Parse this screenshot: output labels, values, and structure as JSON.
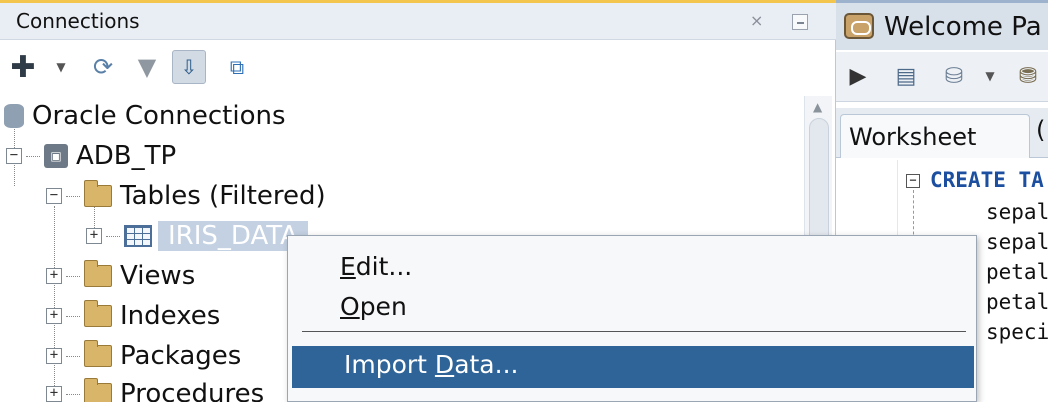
{
  "connections_panel": {
    "title": "Connections",
    "close_glyph": "×"
  },
  "tree": {
    "root": "Oracle Connections",
    "connection": "ADB_TP",
    "tables": "Tables (Filtered)",
    "selected_table": "IRIS_DATA",
    "folders": [
      "Views",
      "Indexes",
      "Packages",
      "Procedures"
    ]
  },
  "context_menu": {
    "items": [
      {
        "label_pre": "",
        "mnemonic": "E",
        "label_post": "dit..."
      },
      {
        "label_pre": "",
        "mnemonic": "O",
        "label_post": "pen"
      },
      {
        "label_pre": "Import ",
        "mnemonic": "D",
        "label_post": "ata..."
      }
    ],
    "highlighted_index": 2,
    "highlight_color": "#2f6498"
  },
  "welcome_panel": {
    "title": "Welcome Pa"
  },
  "worksheet": {
    "tab_label": "Worksheet",
    "second_tab_label": "(",
    "code": {
      "line1_keyword": "CREATE TA",
      "lines": [
        "sepal",
        "sepal",
        "petal",
        "petal",
        "speci"
      ]
    }
  },
  "icons": {
    "add": "add-connection-icon",
    "refresh": "refresh-icon",
    "filter": "filter-icon",
    "schema": "schema-browser-icon",
    "expand": "expand-icon",
    "run": "run-statement-icon",
    "script": "run-script-icon",
    "commit": "commit-icon"
  },
  "colors": {
    "accent_tab": "#f3c54c",
    "selection": "#2f6498",
    "keyword": "#1c4fa0"
  }
}
